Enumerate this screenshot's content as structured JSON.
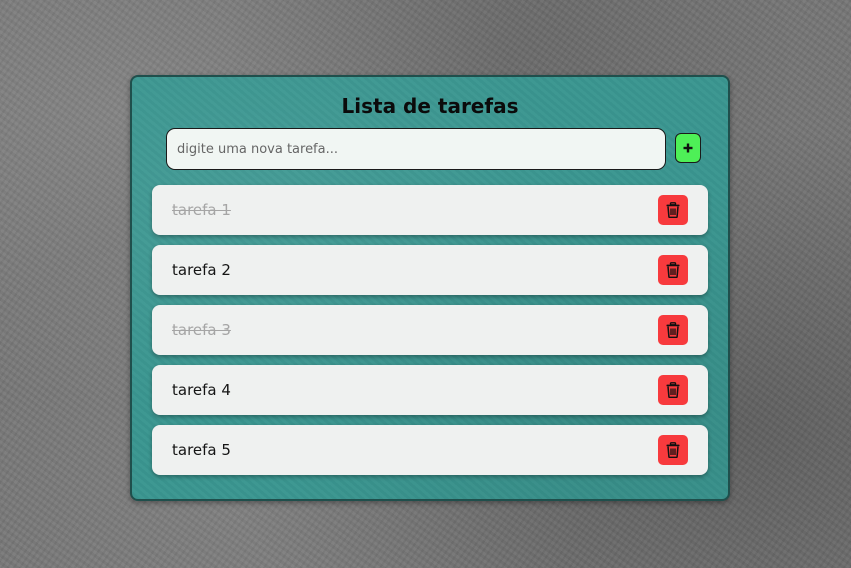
{
  "app": {
    "title": "Lista de tarefas"
  },
  "new_task": {
    "placeholder": "digite uma nova tarefa...",
    "value": "",
    "add_icon": "plus-icon"
  },
  "tasks": [
    {
      "label": "tarefa 1",
      "done": true,
      "delete_icon": "trash-icon"
    },
    {
      "label": "tarefa 2",
      "done": false,
      "delete_icon": "trash-icon"
    },
    {
      "label": "tarefa 3",
      "done": true,
      "delete_icon": "trash-icon"
    },
    {
      "label": "tarefa 4",
      "done": false,
      "delete_icon": "trash-icon"
    },
    {
      "label": "tarefa 5",
      "done": false,
      "delete_icon": "trash-icon"
    }
  ],
  "colors": {
    "card_background": "#3a9690",
    "add_button": "#4ef057",
    "delete_button": "#f73a3d",
    "task_background": "#eff1f0",
    "done_text": "#a5a5a5"
  }
}
